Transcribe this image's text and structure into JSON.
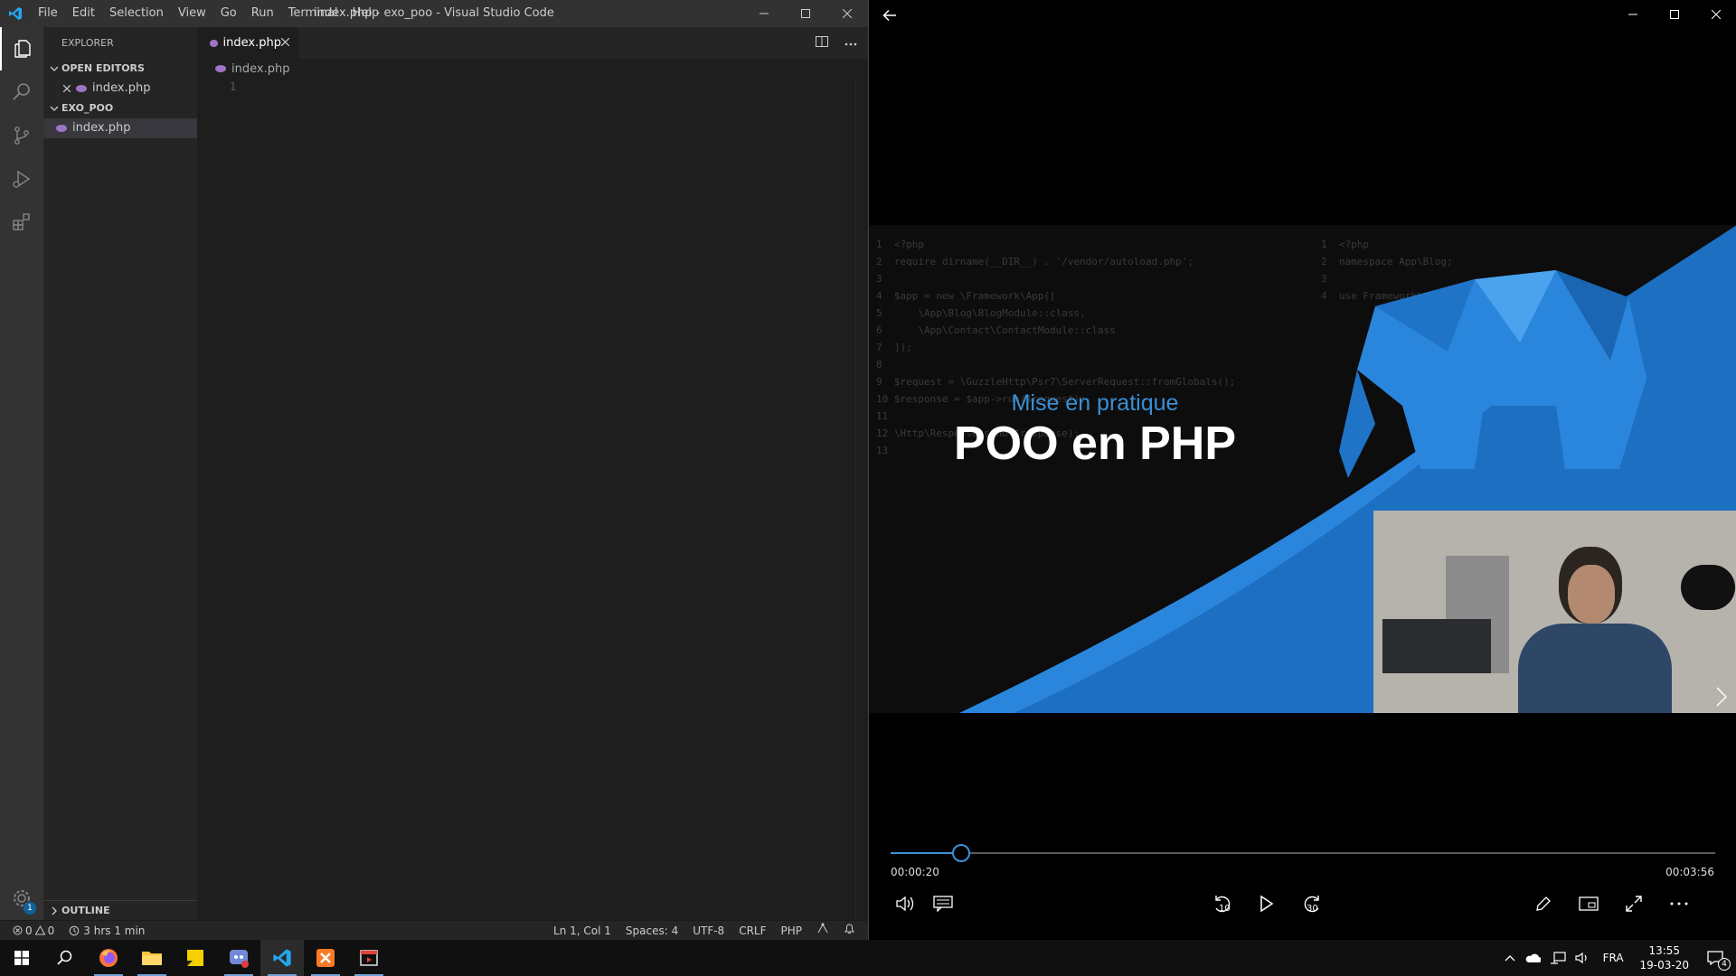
{
  "vscode": {
    "window_title": "index.php - exo_poo - Visual Studio Code",
    "menu": [
      "File",
      "Edit",
      "Selection",
      "View",
      "Go",
      "Run",
      "Terminal",
      "Help"
    ],
    "sidebar": {
      "header": "EXPLORER",
      "open_editors": "OPEN EDITORS",
      "open_file": "index.php",
      "folder": "EXO_POO",
      "folder_file": "index.php",
      "outline": "OUTLINE"
    },
    "settings_badge": "1",
    "tab": "index.php",
    "breadcrumb": "index.php",
    "line_number": "1",
    "status": {
      "problems": "0",
      "warnings": "0",
      "time": "3 hrs 1 min",
      "position": "Ln 1, Col 1",
      "spaces": "Spaces: 4",
      "encoding": "UTF-8",
      "eol": "CRLF",
      "language": "PHP"
    }
  },
  "player": {
    "video_subtitle": "Mise en pratique",
    "video_title": "POO en PHP",
    "code_left": "1  <?php\n2  require dirname(__DIR__) . '/vendor/autoload.php';\n3\n4  $app = new \\Framework\\App([\n5      \\App\\Blog\\BlogModule::class,\n6      \\App\\Contact\\ContactModule::class\n7  ]);\n8\n9  $request = \\GuzzleHttp\\Psr7\\ServerRequest::fromGlobals();\n10 $response = $app->run($request);\n11\n12 \\Http\\Response\\send($response);\n13",
    "code_right": "1  <?php\n2  namespace App\\Blog;\n3\n4  use Framework\\",
    "current_time": "00:00:20",
    "duration": "00:03:56",
    "progress_fraction": 0.085,
    "skip_back": "10",
    "skip_forward": "30"
  },
  "taskbar": {
    "language": "FRA",
    "time": "13:55",
    "date": "19-03-20",
    "notifications": "4"
  },
  "colors": {
    "accent": "#3b8fd6",
    "vscode_bg": "#1e1e1e",
    "php_icon": "#a074c4"
  }
}
